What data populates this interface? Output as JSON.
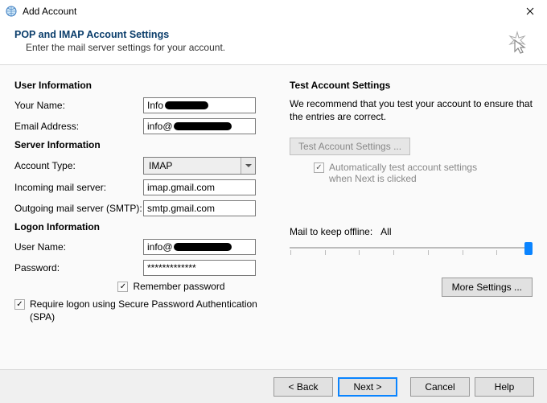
{
  "window": {
    "title": "Add Account"
  },
  "header": {
    "title": "POP and IMAP Account Settings",
    "subtitle": "Enter the mail server settings for your account."
  },
  "left": {
    "section_user": "User Information",
    "your_name_label": "Your Name:",
    "your_name_value": "Info",
    "email_label": "Email Address:",
    "email_value": "info@",
    "section_server": "Server Information",
    "account_type_label": "Account Type:",
    "account_type_value": "IMAP",
    "incoming_label": "Incoming mail server:",
    "incoming_value": "imap.gmail.com",
    "outgoing_label": "Outgoing mail server (SMTP):",
    "outgoing_value": "smtp.gmail.com",
    "section_logon": "Logon Information",
    "user_name_label": "User Name:",
    "user_name_value": "info@",
    "password_label": "Password:",
    "password_value": "*************",
    "remember_label": "Remember password",
    "spa_label": "Require logon using Secure Password Authentication (SPA)"
  },
  "right": {
    "test_title": "Test Account Settings",
    "test_desc": "We recommend that you test your account to ensure that the entries are correct.",
    "test_btn": "Test Account Settings ...",
    "auto_test_label": "Automatically test account settings when Next is clicked",
    "mail_offline_label": "Mail to keep offline:",
    "mail_offline_value": "All",
    "more_settings": "More Settings ..."
  },
  "footer": {
    "back": "< Back",
    "next": "Next >",
    "cancel": "Cancel",
    "help": "Help"
  }
}
